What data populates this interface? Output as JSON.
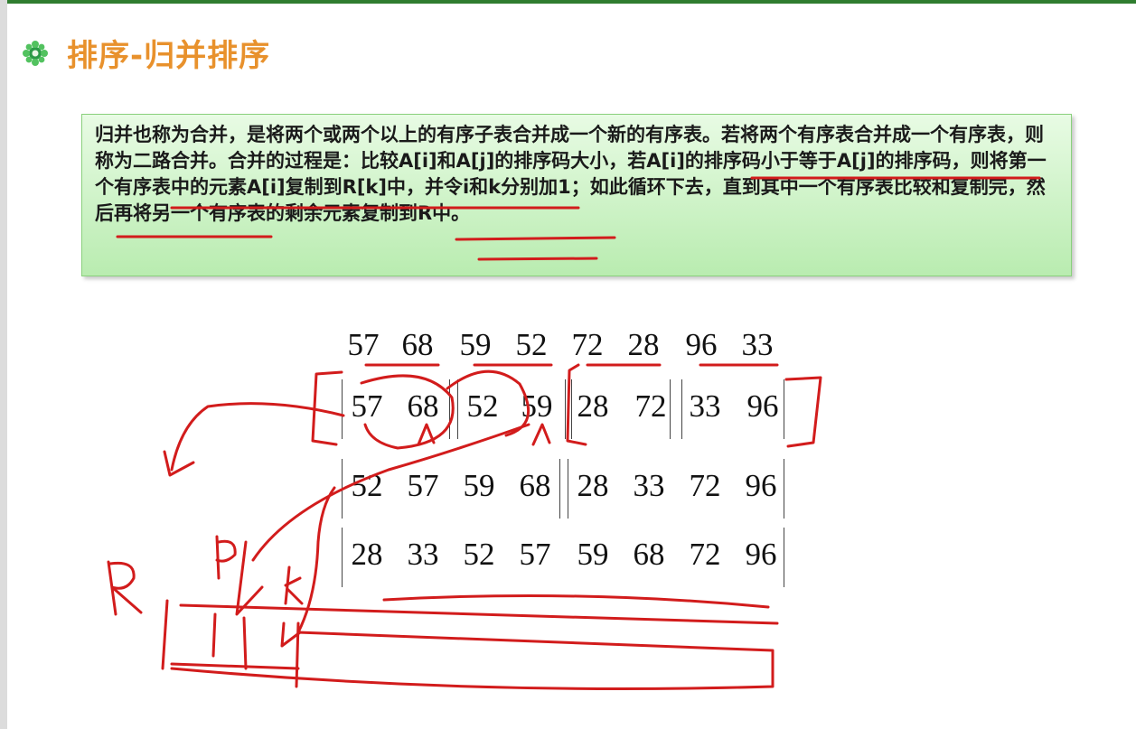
{
  "title": "排序-归并排序",
  "description": "归并也称为合并，是将两个或两个以上的有序子表合并成一个新的有序表。若将两个有序表合并成一个有序表，则称为二路合并。合并的过程是：比较A[i]和A[j]的排序码大小，若A[i]的排序码小于等于A[j]的排序码，则将第一个有序表中的元素A[i]复制到R[k]中，并令i和k分别加1；如此循环下去，直到其中一个有序表比较和复制完，然后再将另一个有序表的剩余元素复制到R中。",
  "rows": [
    [
      "57",
      "68",
      "59",
      "52",
      "72",
      "28",
      "96",
      "33"
    ],
    [
      "57",
      "68",
      "52",
      "59",
      "28",
      "72",
      "33",
      "96"
    ],
    [
      "52",
      "57",
      "59",
      "68",
      "28",
      "33",
      "72",
      "96"
    ],
    [
      "28",
      "33",
      "52",
      "57",
      "59",
      "68",
      "72",
      "96"
    ]
  ],
  "handwriting": {
    "r_label": "R",
    "i_label": "i",
    "k_label": "k"
  },
  "colors": {
    "title": "#e8912c",
    "ink": "#d21c1c",
    "box": "#b9ecb0"
  }
}
